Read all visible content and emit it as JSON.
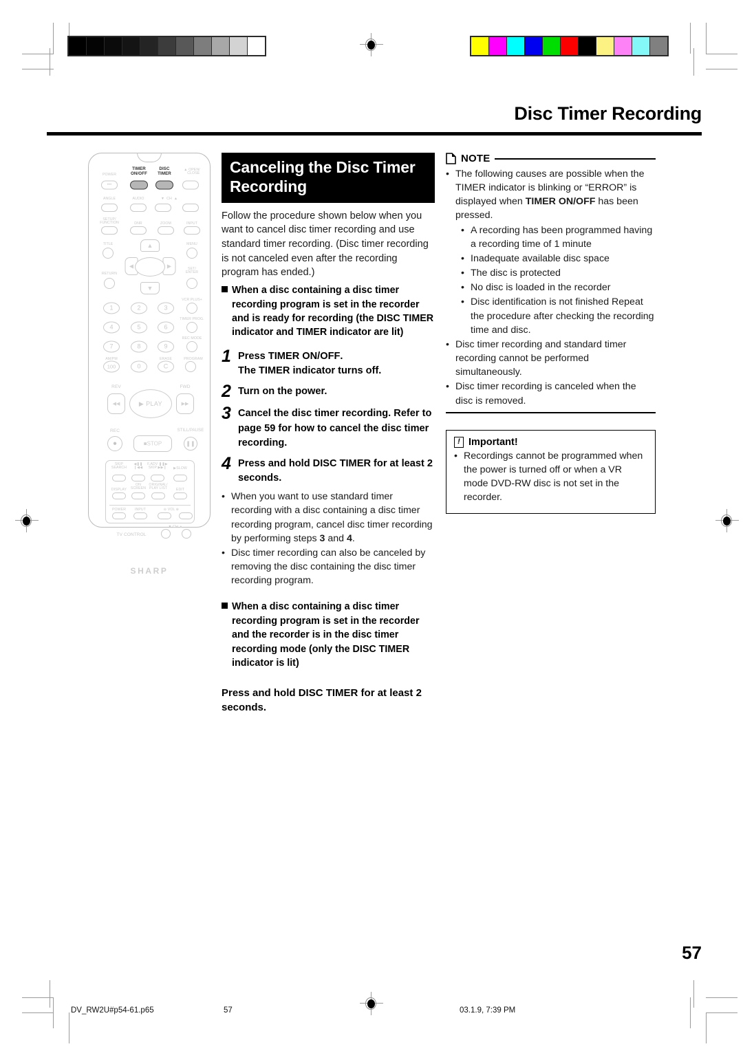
{
  "page": {
    "title": "Disc Timer Recording",
    "number": "57"
  },
  "footer": {
    "filename": "DV_RW2U#p54-61.p65",
    "page": "57",
    "timestamp": "03.1.9, 7:39 PM"
  },
  "calibration": {
    "grayscale": [
      "#000000",
      "#050505",
      "#0c0c0c",
      "#141414",
      "#222222",
      "#3b3b3b",
      "#585858",
      "#7d7d7d",
      "#a7a7a7",
      "#d2d2d2",
      "#ffffff"
    ],
    "colorbar": [
      "#ffff00",
      "#ff00ff",
      "#00ffff",
      "#0000ff",
      "#00e000",
      "#ff0000",
      "#000000",
      "#fff municipal"
    ]
  },
  "main": {
    "heading": "Canceling the Disc Timer Recording",
    "intro": "Follow the procedure shown below when you want to cancel disc timer recording and use standard timer recording. (Disc timer recording is not canceled even after the recording program has ended.)",
    "subhead1": "When a disc containing a disc timer recording program is set in the recorder and is ready for recording (the DISC TIMER indicator and TIMER indicator are lit)",
    "steps": [
      {
        "num": "1",
        "text": "Press TIMER ON/OFF.",
        "sub": "The TIMER indicator turns off."
      },
      {
        "num": "2",
        "text": "Turn on the power.",
        "sub": ""
      },
      {
        "num": "3",
        "text": "Cancel the disc timer recording.",
        "sub": "Refer to page 59 for how to cancel the disc timer recording."
      },
      {
        "num": "4",
        "text": "Press and hold DISC TIMER for at least 2 seconds.",
        "sub": ""
      }
    ],
    "step_bullets": [
      "When you want to use standard timer recording with a disc containing a disc timer recording program, cancel disc timer recording by performing steps 3 and 4.",
      "Disc timer recording can also be canceled by removing the disc containing the disc timer recording program."
    ],
    "subhead2": "When a disc containing a disc timer recording program is set in the recorder and the recorder is in the disc timer recording mode (only the DISC TIMER indicator is lit)",
    "closing": "Press and hold DISC TIMER for at least 2 seconds."
  },
  "note": {
    "label": "NOTE",
    "bullets": [
      "The following causes are possible when the TIMER indicator is blinking or “ERROR” is displayed when TIMER ON/OFF has been pressed.",
      "Disc timer recording and standard timer recording cannot be performed simultaneously.",
      "Disc timer recording is canceled when the disc is removed."
    ],
    "sub_bullets": [
      "A recording has been programmed having a recording time of 1 minute",
      "Inadequate available disc space",
      "The disc is protected",
      "No disc is loaded in the recorder",
      "Disc identification is not finished Repeat the procedure after checking the recording time and disc."
    ]
  },
  "important": {
    "label": "Important!",
    "mark": "!",
    "bullets": [
      "Recordings cannot be programmed when the power is turned off or when a VR mode DVD-RW disc is not set in the recorder."
    ]
  },
  "remote": {
    "brand": "SHARP",
    "highlighted_buttons": [
      "TIMER ON/OFF",
      "DISC TIMER"
    ],
    "labels": {
      "power": "POWER",
      "timer_onoff": "TIMER\nON/OFF",
      "disc_timer": "DISC\nTIMER",
      "open_close": "OPEN/\nCLOSE",
      "angle": "ANGLE",
      "audio": "AUDIO",
      "ch": "CH",
      "setup_function": "SETUP/\nFUNCTION",
      "dnr": "DNR",
      "zoom": "ZOOM",
      "input": "INPUT",
      "title": "TITLE",
      "menu": "MENU",
      "return": "RETURN",
      "set_enter": "SET/\nENTER",
      "vcr_plus": "VCR PLUS+",
      "timer_prog": "TIMER PROG.",
      "rec_mode": "REC MODE",
      "am_pm": "AM/PM",
      "erase": "ERASE",
      "program": "PROGRAM",
      "rev": "REV",
      "fwd": "FWD",
      "play": "PLAY",
      "rec": "REC",
      "stop": "STOP",
      "still_pause": "STILL/PAUSE",
      "skip_search": "SKIP\nSEARCH",
      "f_adv_skip": "F.ADV\nSKIP",
      "slow": "SLOW",
      "display": "DISPLAY",
      "on_screen": "ON\nSCREEN",
      "original_playlist": "ORIGINAL/\nPLAY LIST",
      "edit": "EDIT",
      "tv_power": "POWER",
      "tv_input": "INPUT",
      "vol": "VOL",
      "tv_control": "TV CONTROL"
    },
    "numbers": [
      "1",
      "2",
      "3",
      "4",
      "5",
      "6",
      "7",
      "8",
      "9",
      "100",
      "0",
      "C"
    ]
  }
}
